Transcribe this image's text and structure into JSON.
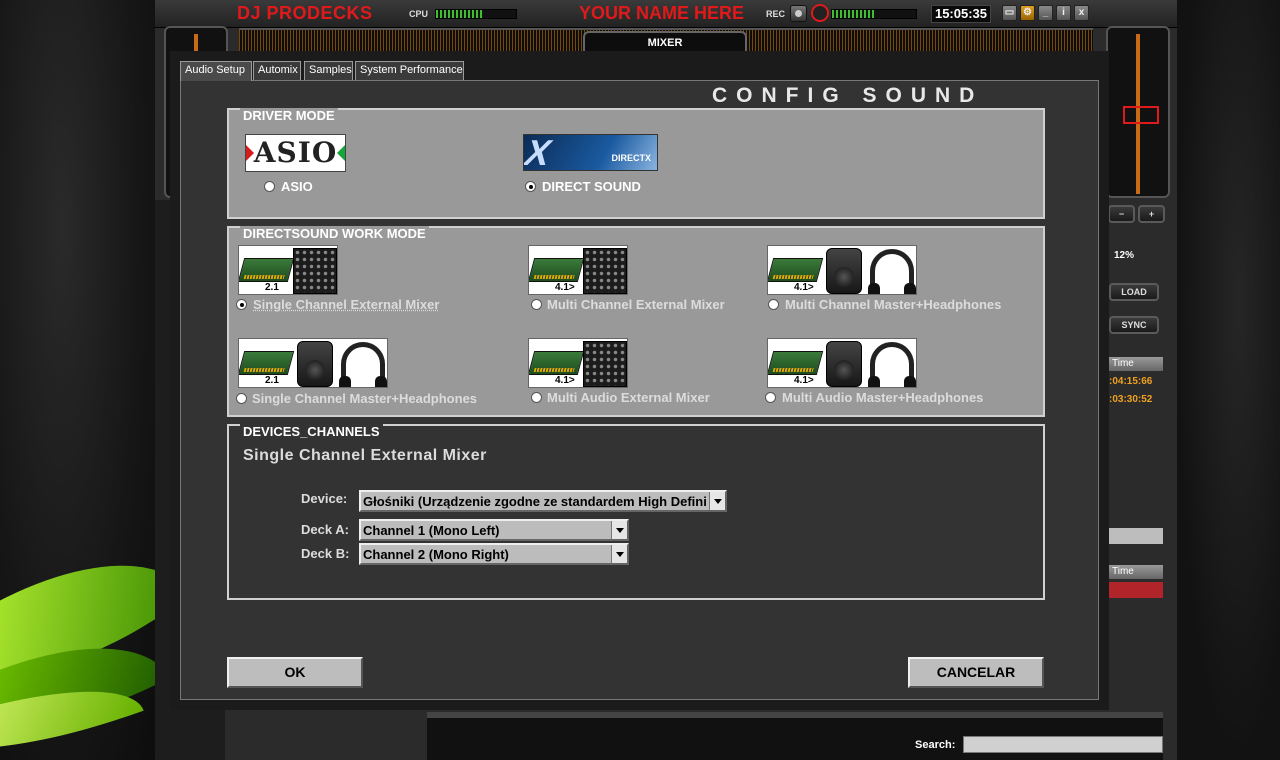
{
  "background_app": {
    "brand": "DJ PRODECKS",
    "cpu_label": "CPU",
    "user_name": "YOUR NAME HERE",
    "rec_label": "REC",
    "clock": "15:05:35",
    "window_buttons": [
      "⚙",
      "_",
      "i",
      "x"
    ],
    "mixer_tab": "MIXER",
    "pitch_minus": "−",
    "pitch_plus": "+",
    "pitch_percent": "12%",
    "load_label": "LOAD",
    "sync_label": "SYNC",
    "playlist_time_header": "Time",
    "playlist_times": [
      ":04:15:66",
      ":03:30:52"
    ],
    "playlist2_time_header": "Time",
    "search_label": "Search:",
    "search_value": ""
  },
  "dialog": {
    "tabs": [
      "Audio Setup",
      "Automix",
      "Samples",
      "System Performance"
    ],
    "active_tab": "Audio Setup",
    "title": "CONFIG SOUND",
    "driver_mode": {
      "title": "DRIVER MODE",
      "options": [
        {
          "label": "ASIO",
          "logo_text": "ASIO",
          "checked": false
        },
        {
          "label": "DIRECT SOUND",
          "logo_text": "DIRECTX",
          "checked": true
        }
      ]
    },
    "work_mode": {
      "title": "DIRECTSOUND WORK MODE",
      "options": [
        {
          "label": "Single Channel External Mixer",
          "tag": "2.1",
          "checked": true
        },
        {
          "label": "Multi Channel External Mixer",
          "tag": "4.1>",
          "checked": false
        },
        {
          "label": "Multi Channel Master+Headphones",
          "tag": "4.1>",
          "checked": false
        },
        {
          "label": "Single Channel Master+Headphones",
          "tag": "2.1",
          "checked": false
        },
        {
          "label": "Multi Audio External Mixer",
          "tag": "4.1>",
          "checked": false
        },
        {
          "label": "Multi Audio Master+Headphones",
          "tag": "4.1>",
          "checked": false
        }
      ]
    },
    "devices": {
      "title": "DEVICES_CHANNELS",
      "mode_name": "Single Channel External Mixer",
      "device_label": "Device:",
      "device_value": "Głośniki (Urządzenie zgodne ze standardem High Definition Audio)",
      "deck_a_label": "Deck A:",
      "deck_a_value": "Channel 1 (Mono Left)",
      "deck_b_label": "Deck B:",
      "deck_b_value": "Channel 2 (Mono Right)"
    },
    "ok_label": "OK",
    "cancel_label": "CANCELAR"
  },
  "colors": {
    "brand_red": "#e0191b",
    "group_bg": "#999999",
    "dialog_bg": "#333333",
    "accent_orange": "#f0a020"
  }
}
